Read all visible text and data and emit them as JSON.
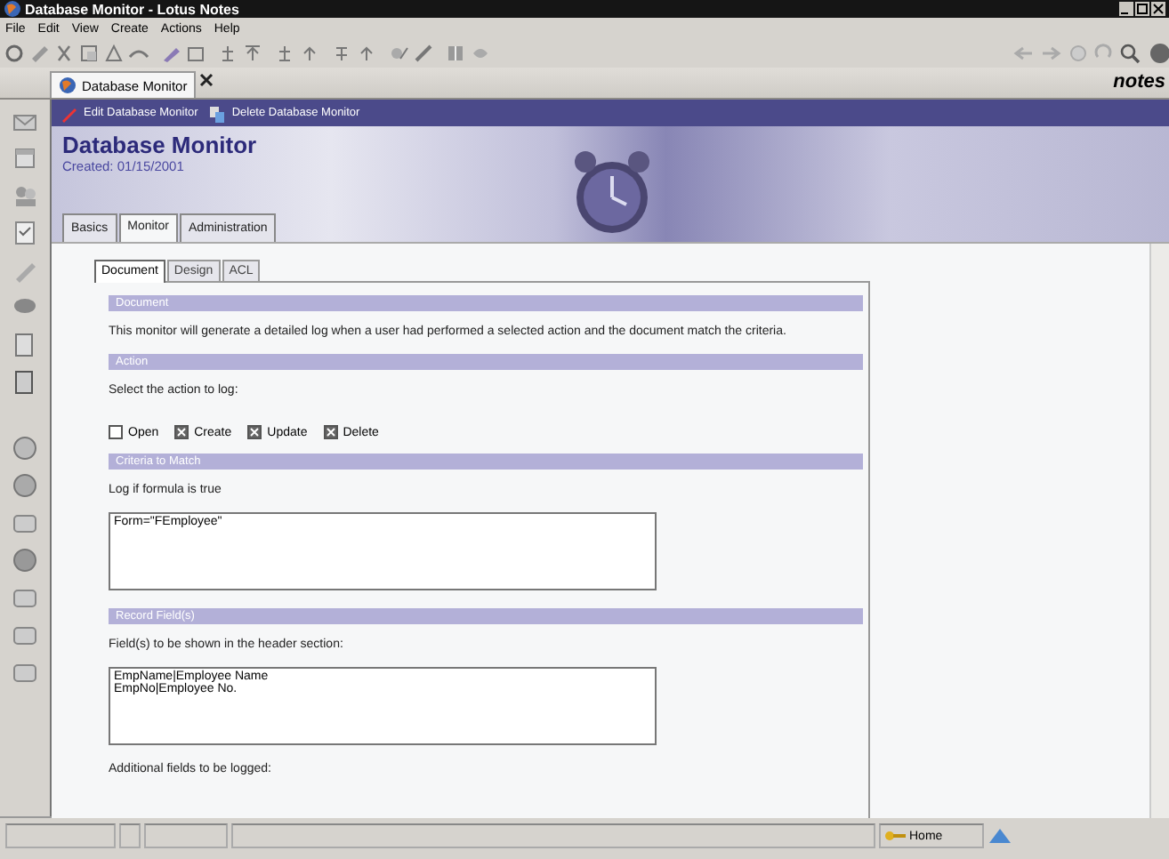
{
  "window": {
    "title": "Database Monitor - Lotus Notes"
  },
  "menu": [
    {
      "label": "File"
    },
    {
      "label": "Edit"
    },
    {
      "label": "View"
    },
    {
      "label": "Create"
    },
    {
      "label": "Actions"
    },
    {
      "label": "Help"
    }
  ],
  "tabs": [
    {
      "label": "Database Monitor",
      "selected": true
    }
  ],
  "brand": "notes",
  "actions": [
    {
      "label": "Edit Database Monitor",
      "kind": "edit"
    },
    {
      "label": "Delete Database Monitor",
      "kind": "delete"
    }
  ],
  "form": {
    "title": "Database Monitor",
    "created": "Created: 01/15/2001"
  },
  "form_tabs": [
    {
      "label": "Basics",
      "selected": false
    },
    {
      "label": "Monitor",
      "selected": true
    },
    {
      "label": "Administration",
      "selected": false
    }
  ],
  "sub_tabs": [
    {
      "label": "Document",
      "selected": true
    },
    {
      "label": "Design",
      "selected": false
    },
    {
      "label": "ACL",
      "selected": false
    }
  ],
  "sections": [
    {
      "heading": "Document",
      "items": [
        {
          "kind": "text",
          "text": "This monitor will generate a detailed log when a user had performed a selected action and the document match the criteria."
        }
      ]
    },
    {
      "heading": "Action",
      "items": [
        {
          "kind": "text",
          "text": "Select the action to log:"
        },
        {
          "kind": "checkboxes",
          "options": [
            {
              "label": "Open",
              "checked": false
            },
            {
              "label": "Create",
              "checked": true
            },
            {
              "label": "Update",
              "checked": true
            },
            {
              "label": "Delete",
              "checked": true
            }
          ]
        }
      ]
    },
    {
      "heading": "Criteria to Match",
      "items": [
        {
          "kind": "text",
          "text": "Log if formula is true"
        },
        {
          "kind": "field",
          "lines": [
            "Form=\"FEmployee\""
          ]
        }
      ]
    },
    {
      "heading": "Record Field(s)",
      "items": [
        {
          "kind": "text",
          "text": "Field(s) to be shown in the header section:"
        },
        {
          "kind": "field",
          "lines": [
            "EmpName|Employee Name",
            "EmpNo|Employee No."
          ]
        },
        {
          "kind": "text",
          "text": "Additional fields to be logged:"
        }
      ]
    }
  ],
  "status_bar": {
    "location": "Home"
  }
}
